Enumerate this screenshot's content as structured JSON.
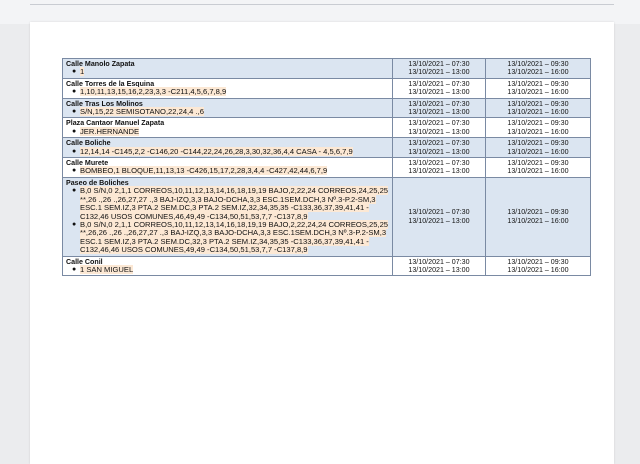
{
  "rows": [
    {
      "street": "Calle Manolo Zapata",
      "items": [
        "1"
      ],
      "start": [
        "13/10/2021 – 07:30",
        "13/10/2021 – 13:00"
      ],
      "end": [
        "13/10/2021 – 09:30",
        "13/10/2021 – 16:00"
      ]
    },
    {
      "street": "Calle Torres de la Esquina",
      "items": [
        "1,10,11,13,15,16,2,23,3,3 -C211,4,5,6,7,8,9"
      ],
      "start": [
        "13/10/2021 – 07:30",
        "13/10/2021 – 13:00"
      ],
      "end": [
        "13/10/2021 – 09:30",
        "13/10/2021 – 16:00"
      ]
    },
    {
      "street": "Calle Tras Los Molinos",
      "items": [
        "S/N,15,22 SEMISOTANO,22,24,4 .,6"
      ],
      "start": [
        "13/10/2021 – 07:30",
        "13/10/2021 – 13:00"
      ],
      "end": [
        "13/10/2021 – 09:30",
        "13/10/2021 – 16:00"
      ]
    },
    {
      "street": "Plaza Cantaor Manuel Zapata",
      "items": [
        "JER.HERNANDE"
      ],
      "start": [
        "13/10/2021 – 07:30",
        "13/10/2021 – 13:00"
      ],
      "end": [
        "13/10/2021 – 09:30",
        "13/10/2021 – 16:00"
      ]
    },
    {
      "street": "Calle Boliche",
      "items": [
        "12,14,14 -C145,2,2 -C146,20 -C144,22,24,26,28,3,30,32,36,4,4 CASA - 4,5,6,7,9"
      ],
      "start": [
        "13/10/2021 – 07:30",
        "13/10/2021 – 13:00"
      ],
      "end": [
        "13/10/2021 – 09:30",
        "13/10/2021 – 16:00"
      ]
    },
    {
      "street": "Calle Murete",
      "items": [
        "BOMBEO,1 BLOQUE,11,13,13 -C426,15,17,2,28,3,4,4 -C427,42,44,6,7,9"
      ],
      "start": [
        "13/10/2021 – 07:30",
        "13/10/2021 – 13:00"
      ],
      "end": [
        "13/10/2021 – 09:30",
        "13/10/2021 – 16:00"
      ]
    },
    {
      "street": "Paseo de Boliches",
      "items": [
        "B,0 S/N,0 2,1,1 CORREOS,10,11,12,13,14,16,18,19,19 BAJO,2,22,24 CORREOS,24,25,25 **,26 .,26 .,26,27,27 .,3 BAJ-IZQ,3,3 BAJO-DCHA,3,3 ESC.1SEM.DCH,3 Nº.3-P.2-SM,3 ESC.1 SEM.IZ,3 PTA.2 SEM.DC,3 PTA.2 SEM.IZ,32,34,35,35 -C133,36,37,39,41,41 -C132,46 USOS COMUNES,46,49,49 -C134,50,51,53,7,7 -C137,8,9",
        "B,0 S/N,0 2,1,1 CORREOS,10,11,12,13,14,16,18,19,19 BAJO,2,22,24,24 CORREOS,25,25 **,26,26 .,26 .,26,27,27 .,3 BAJ-IZQ,3,3 BAJO-DCHA,3,3 ESC.1SEM.DCH,3 Nº.3-P.2-SM,3 ESC.1 SEM.IZ,3 PTA.2 SEM.DC,32,3 PTA.2 SEM.IZ,34,35,35 -C133,36,37,39,41,41 -C132,46,46 USOS COMUNES,49,49 -C134,50,51,53,7,7 -C137,8,9"
      ],
      "start": [
        "13/10/2021 – 07:30",
        "13/10/2021 – 13:00"
      ],
      "end": [
        "13/10/2021 – 09:30",
        "13/10/2021 – 16:00"
      ]
    },
    {
      "street": "Calle Conil",
      "items": [
        "1 SAN MIGUEL"
      ],
      "start": [
        "13/10/2021 – 07:30",
        "13/10/2021 – 13:00"
      ],
      "end": [
        "13/10/2021 – 09:30",
        "13/10/2021 – 16:00"
      ]
    }
  ]
}
